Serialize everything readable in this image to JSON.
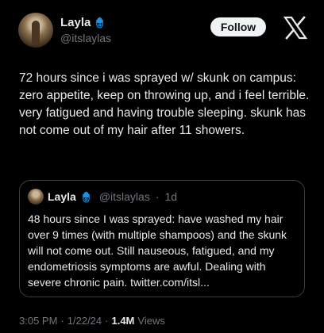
{
  "author": {
    "display_name": "Layla",
    "handle": "@itslaylas",
    "badge_icon": "hamsa-icon"
  },
  "follow_label": "Follow",
  "brand_icon": "x-logo-icon",
  "tweet_text": "72 hours since i was sprayed w/ skunk on campus: zero appetite, keep on throwing up, and i feel terrible. very fatigued and having trouble sleeping. skunk has not come out of my hair after 11 showers.",
  "quoted": {
    "display_name": "Layla",
    "handle": "@itslaylas",
    "separator": "·",
    "age": "1d",
    "text": "48 hours since I was sprayed: have washed my hair over 9 times (with multiple shampoos) and the skunk will not come out. Still nauseous, fatigued, and my endometriosis symptoms are awful. Dealing with severe chronic pain. twitter.com/itsl..."
  },
  "footer": {
    "time": "3:05 PM",
    "separator1": "·",
    "date": "1/22/24",
    "separator2": "·",
    "views_count": "1.4M",
    "views_label": "Views"
  },
  "colors": {
    "background": "#000000",
    "text": "#e7e9ea",
    "muted": "#71767b",
    "badge": "#1d9bf0"
  }
}
